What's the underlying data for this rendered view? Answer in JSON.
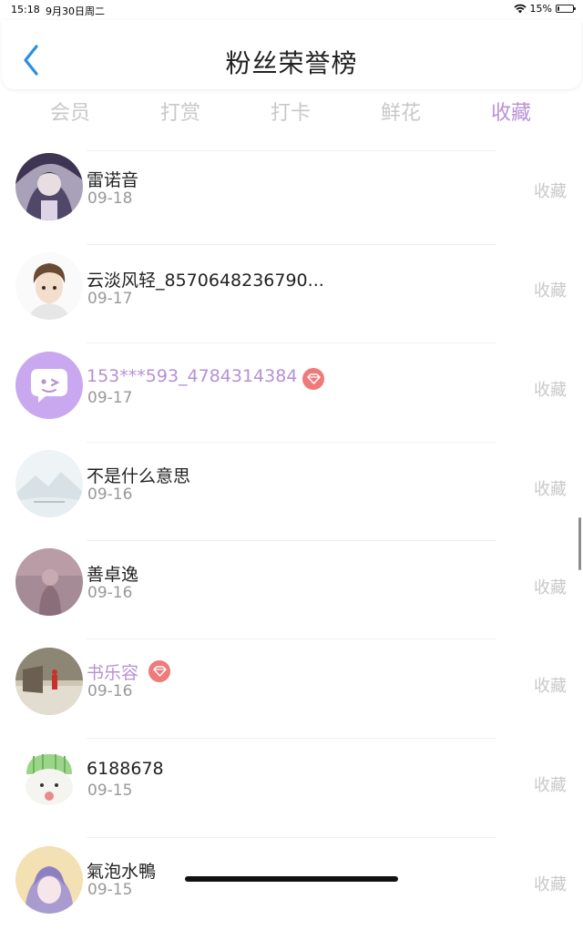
{
  "status_bar": {
    "time": "15:18",
    "date": "9月30日周二",
    "battery": "15%",
    "battery_level": 0.15
  },
  "header": {
    "title": "粉丝荣誉榜"
  },
  "tabs": [
    {
      "label": "会员"
    },
    {
      "label": "打赏"
    },
    {
      "label": "打卡"
    },
    {
      "label": "鲜花"
    },
    {
      "label": "收藏",
      "active": true
    }
  ],
  "colors": {
    "accent": "#b990d6",
    "vip_name": "#b590d4",
    "badge": "#f07979",
    "muted": "#c9c9c9"
  },
  "fans": [
    {
      "name": "雷诺音",
      "date": "09-18",
      "action": "收藏",
      "vip": false,
      "avatar": "anime-girl-avatar"
    },
    {
      "name": "云淡风轻_8570648236790...",
      "date": "09-17",
      "action": "收藏",
      "vip": false,
      "avatar": "anime-boy-avatar"
    },
    {
      "name": "153***593_4784314384",
      "date": "09-17",
      "action": "收藏",
      "vip": true,
      "avatar": "default-chat-avatar"
    },
    {
      "name": "不是什么意思",
      "date": "09-16",
      "action": "收藏",
      "vip": false,
      "avatar": "landscape-avatar"
    },
    {
      "name": "善卓逸",
      "date": "09-16",
      "action": "收藏",
      "vip": false,
      "avatar": "photo-avatar"
    },
    {
      "name": "书乐容",
      "date": "09-16",
      "action": "收藏",
      "vip": true,
      "avatar": "scenery-avatar"
    },
    {
      "name": "6188678",
      "date": "09-15",
      "action": "收藏",
      "vip": false,
      "avatar": "cartoon-avatar"
    },
    {
      "name": "氣泡水鴨",
      "date": "09-15",
      "action": "收藏",
      "vip": false,
      "avatar": "anime-avatar"
    }
  ]
}
